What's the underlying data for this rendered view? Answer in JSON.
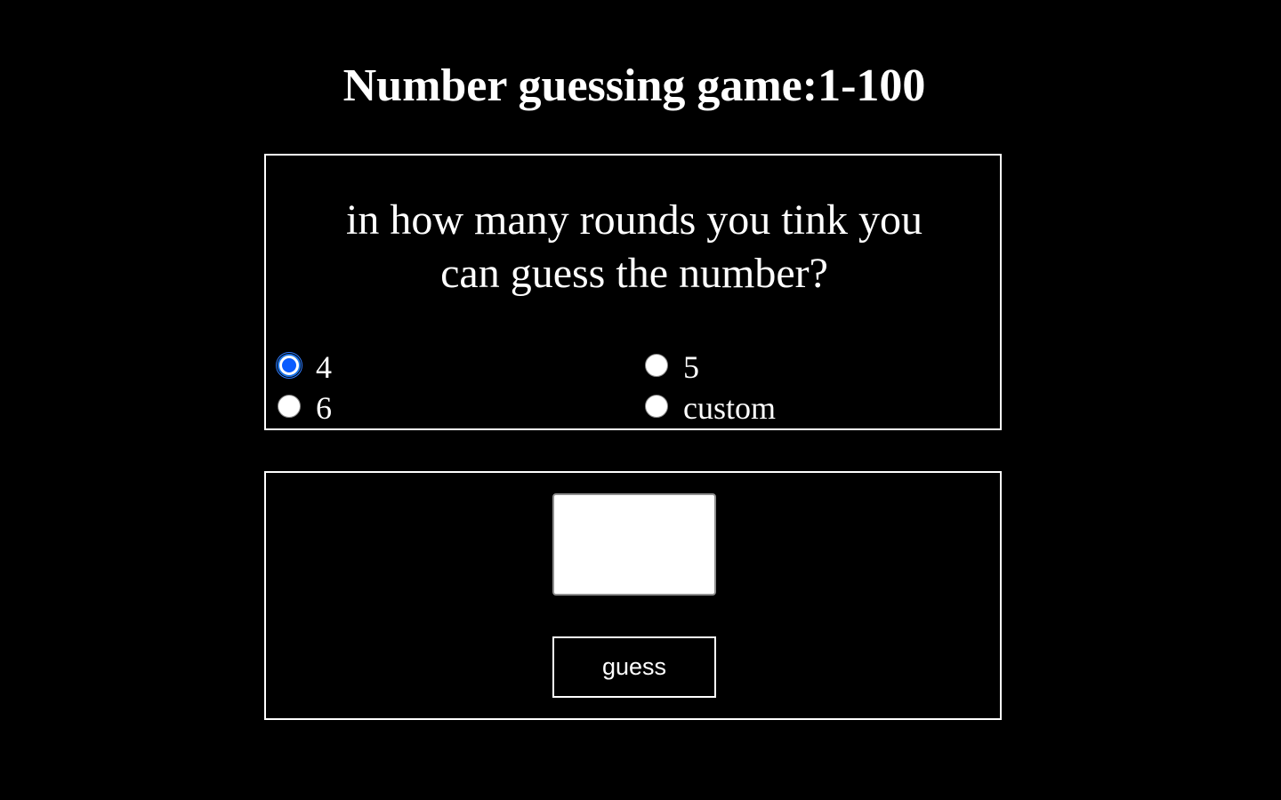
{
  "page": {
    "title": "Number guessing game:1-100"
  },
  "rounds": {
    "question": "in how many rounds you tink you can guess the number?",
    "options": [
      {
        "label": "4",
        "checked": true
      },
      {
        "label": "5",
        "checked": false
      },
      {
        "label": "6",
        "checked": false
      },
      {
        "label": "custom",
        "checked": false
      }
    ]
  },
  "guess": {
    "input_value": "",
    "button_label": "guess"
  },
  "colors": {
    "background": "#000000",
    "text": "#ffffff",
    "border": "#ffffff",
    "radio_accent": "#0a5cff"
  }
}
